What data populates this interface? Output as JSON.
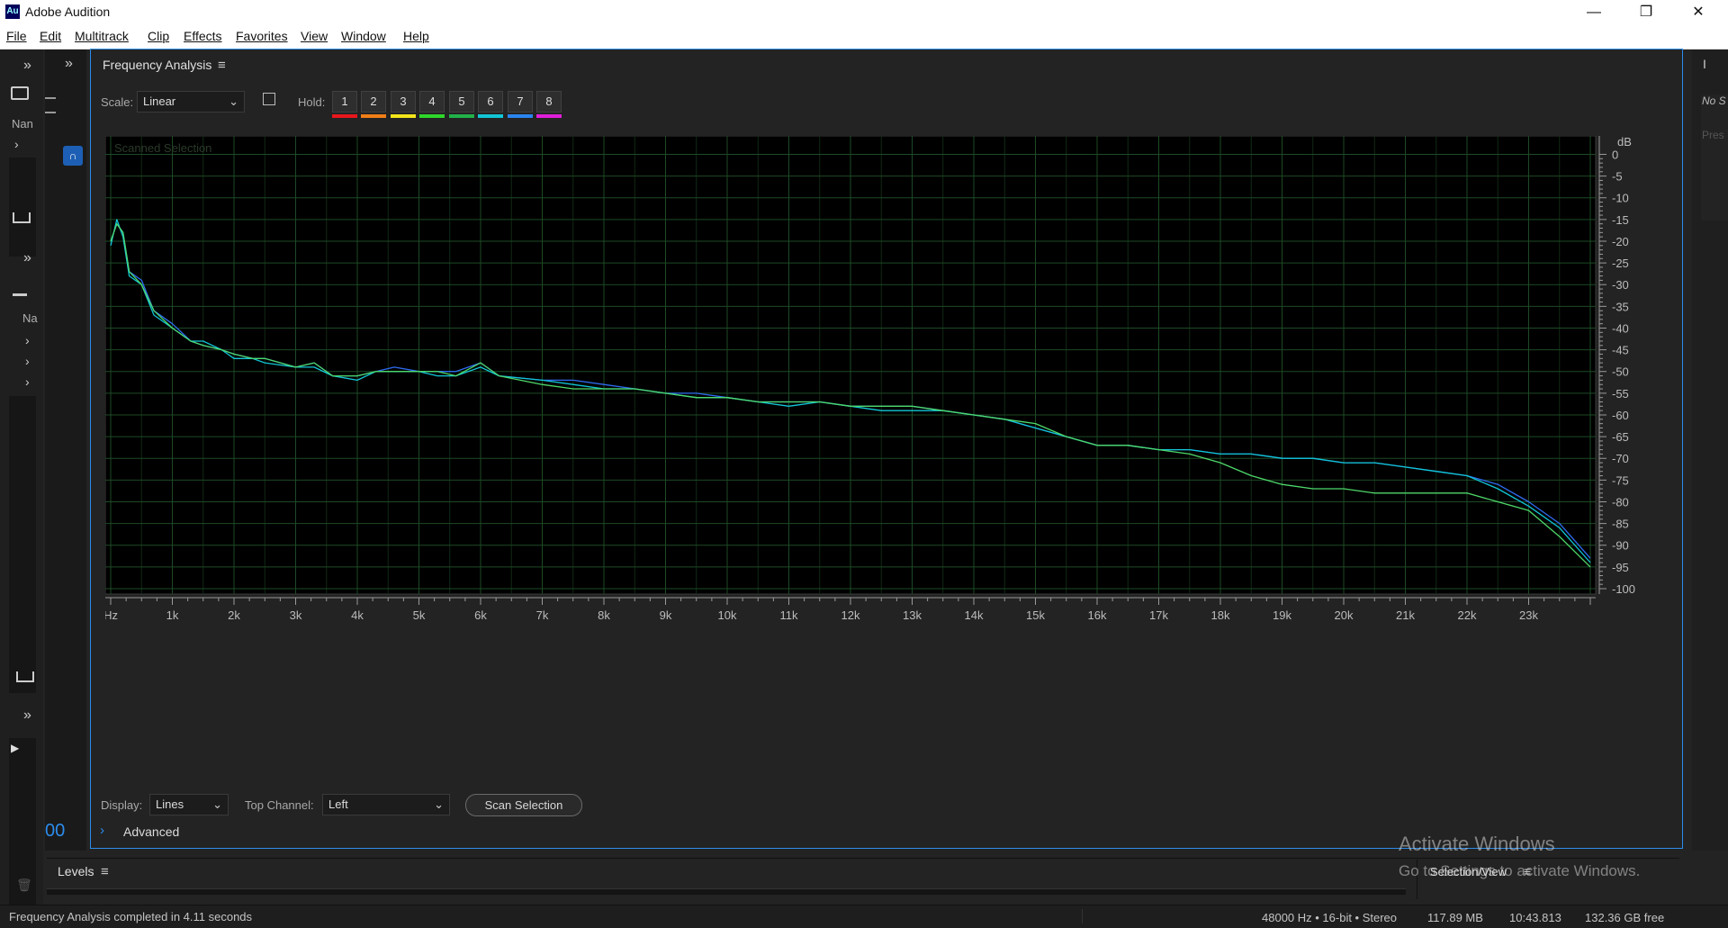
{
  "window": {
    "title": "Adobe Audition",
    "icon_label": "Au",
    "minimize": "—",
    "restore": "❐",
    "close": "✕"
  },
  "menu": [
    "File",
    "Edit",
    "Multitrack",
    "Clip",
    "Effects",
    "Favorites",
    "View",
    "Window",
    "Help"
  ],
  "left_rail": {
    "nan": "Nan",
    "na": "Na",
    "time_fragment": "00"
  },
  "right_rail": {
    "no_s": "No S",
    "pres": "Pres"
  },
  "panel": {
    "title": "Frequency Analysis",
    "scale_label": "Scale:",
    "scale_value": "Linear",
    "hold_label": "Hold:",
    "hold_buttons": [
      "1",
      "2",
      "3",
      "4",
      "5",
      "6",
      "7",
      "8"
    ],
    "hold_colors": [
      "#e8161c",
      "#f07e17",
      "#f2e51a",
      "#2ed72b",
      "#21b24a",
      "#11c6d6",
      "#2a84f0",
      "#e01ed8"
    ],
    "display_label": "Display:",
    "display_value": "Lines",
    "top_channel_label": "Top Channel:",
    "top_channel_value": "Left",
    "scan_button": "Scan Selection",
    "advanced_label": "Advanced"
  },
  "chart_data": {
    "type": "line",
    "title": "Scanned Selection",
    "xlabel": "Hz",
    "ylabel": "dB",
    "x_ticks": [
      "1k",
      "2k",
      "3k",
      "4k",
      "5k",
      "6k",
      "7k",
      "8k",
      "9k",
      "10k",
      "11k",
      "12k",
      "13k",
      "14k",
      "15k",
      "16k",
      "17k",
      "18k",
      "19k",
      "20k",
      "21k",
      "22k",
      "23k"
    ],
    "y_ticks": [
      "0",
      "-5",
      "-10",
      "-15",
      "-20",
      "-25",
      "-30",
      "-35",
      "-40",
      "-45",
      "-50",
      "-55",
      "-60",
      "-65",
      "-70",
      "-75",
      "-80",
      "-85",
      "-90",
      "-95",
      "-100"
    ],
    "xlim": [
      0,
      24000
    ],
    "ylim": [
      -100,
      3
    ],
    "grid": true,
    "x": [
      0,
      100,
      200,
      300,
      500,
      700,
      1000,
      1300,
      1500,
      1800,
      2000,
      2300,
      2500,
      3000,
      3300,
      3600,
      4000,
      4300,
      4600,
      5000,
      5300,
      5600,
      6000,
      6300,
      7000,
      7500,
      8000,
      8500,
      9000,
      9500,
      10000,
      10500,
      11000,
      11500,
      12000,
      12500,
      13000,
      13500,
      14000,
      14500,
      15000,
      15500,
      16000,
      16500,
      17000,
      17500,
      18000,
      18500,
      19000,
      19500,
      20000,
      20500,
      21000,
      21500,
      22000,
      22500,
      23000,
      23500,
      24000
    ],
    "series": [
      {
        "color": "#2e6cf0",
        "values": [
          -20,
          -16,
          -18,
          -27,
          -29,
          -36,
          -39,
          -43,
          -44,
          -45,
          -46,
          -47,
          -47,
          -49,
          -48,
          -51,
          -51,
          -50,
          -49,
          -50,
          -50,
          -50,
          -48,
          -51,
          -52,
          -52,
          -53,
          -54,
          -55,
          -55,
          -56,
          -57,
          -57,
          -57,
          -58,
          -58,
          -58,
          -59,
          -60,
          -61,
          -63,
          -65,
          -67,
          -67,
          -68,
          -68,
          -69,
          -69,
          -70,
          -70,
          -71,
          -71,
          -72,
          -73,
          -74,
          -76,
          -80,
          -85,
          -93
        ]
      },
      {
        "color": "#11c6d6",
        "values": [
          -21,
          -15,
          -19,
          -28,
          -30,
          -37,
          -40,
          -43,
          -43,
          -45,
          -47,
          -47,
          -48,
          -49,
          -49,
          -51,
          -52,
          -50,
          -50,
          -50,
          -51,
          -51,
          -49,
          -51,
          -52,
          -53,
          -54,
          -54,
          -55,
          -56,
          -56,
          -57,
          -58,
          -57,
          -58,
          -59,
          -59,
          -59,
          -60,
          -61,
          -63,
          -65,
          -67,
          -67,
          -68,
          -68,
          -69,
          -69,
          -70,
          -70,
          -71,
          -71,
          -72,
          -73,
          -74,
          -77,
          -81,
          -86,
          -94
        ]
      },
      {
        "color": "#4ed86a",
        "values": [
          -20,
          -16,
          -18,
          -27,
          -30,
          -36,
          -40,
          -43,
          -44,
          -45,
          -46,
          -47,
          -47,
          -49,
          -48,
          -51,
          -51,
          -50,
          -50,
          -50,
          -50,
          -51,
          -48,
          -51,
          -53,
          -54,
          -54,
          -54,
          -55,
          -56,
          -56,
          -57,
          -57,
          -57,
          -58,
          -58,
          -58,
          -59,
          -60,
          -61,
          -62,
          -65,
          -67,
          -67,
          -68,
          -69,
          -71,
          -74,
          -76,
          -77,
          -77,
          -78,
          -78,
          -78,
          -78,
          -80,
          -82,
          -88,
          -95
        ]
      }
    ]
  },
  "levels": {
    "title": "Levels"
  },
  "selection_view": "Selection/View",
  "watermark": {
    "line1": "Activate Windows",
    "line2": "Go to Settings to activate Windows."
  },
  "status": {
    "message": "Frequency Analysis completed in 4.11 seconds",
    "format": "48000 Hz • 16-bit • Stereo",
    "size": "117.89 MB",
    "duration": "10:43.813",
    "free": "132.36 GB free"
  }
}
